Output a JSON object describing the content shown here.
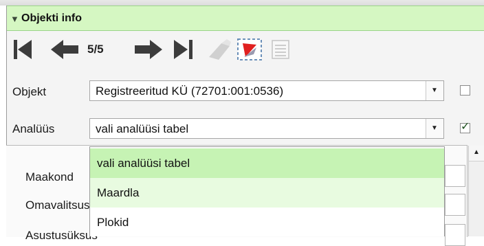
{
  "panel": {
    "title": "Objekti info",
    "collapse_glyph": "▼"
  },
  "toolbar": {
    "counter": "5/5",
    "icons": [
      "first-record-icon",
      "previous-record-icon",
      "next-record-icon",
      "last-record-icon",
      "erase-icon",
      "zoom-to-object-icon",
      "table-view-icon"
    ]
  },
  "object_row": {
    "label": "Objekt",
    "value": "Registreeritud KÜ (72701:001:0536)",
    "checkbox_checked": false
  },
  "analysis_row": {
    "label": "Analüüs",
    "value": "vali analüüsi tabel",
    "checkbox_checked": true,
    "check_glyph": "✓"
  },
  "dropdown": {
    "options": [
      {
        "label": "vali analüüsi tabel",
        "state": "selected"
      },
      {
        "label": "Maardla",
        "state": "hover"
      },
      {
        "label": "Plokid",
        "state": "normal"
      }
    ]
  },
  "behind_fields": {
    "labels": [
      "Maakond",
      "Omavalitsus",
      "Asustusüksus"
    ]
  },
  "glyphs": {
    "down_arrow": "▼",
    "up_arrow": "▲"
  },
  "colors": {
    "header_bg": "#d5f7c2",
    "selected_bg": "#c6f3b4",
    "hover_bg": "#e8fbe0",
    "nav_icon": "#7d7d7d",
    "active_nav_icon": "#3c3c3c"
  }
}
